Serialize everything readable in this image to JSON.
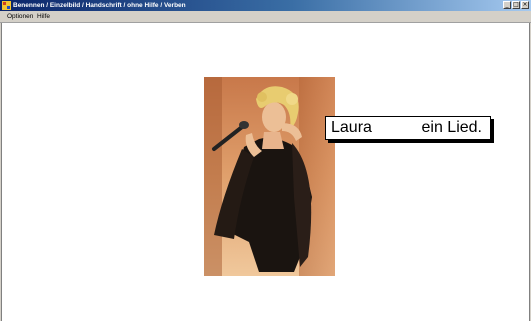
{
  "window": {
    "title": "Benennen / Einzelbild / Handschrift / ohne Hilfe / Verben",
    "controls": [
      "minimize",
      "maximize",
      "close"
    ]
  },
  "menu": {
    "items": [
      {
        "label": "Optionen"
      },
      {
        "label": "Hilfe"
      }
    ]
  },
  "exercise": {
    "picture": "woman-singing-into-microphone",
    "sentence": {
      "subject": "Laura",
      "object": "ein Lied."
    }
  }
}
